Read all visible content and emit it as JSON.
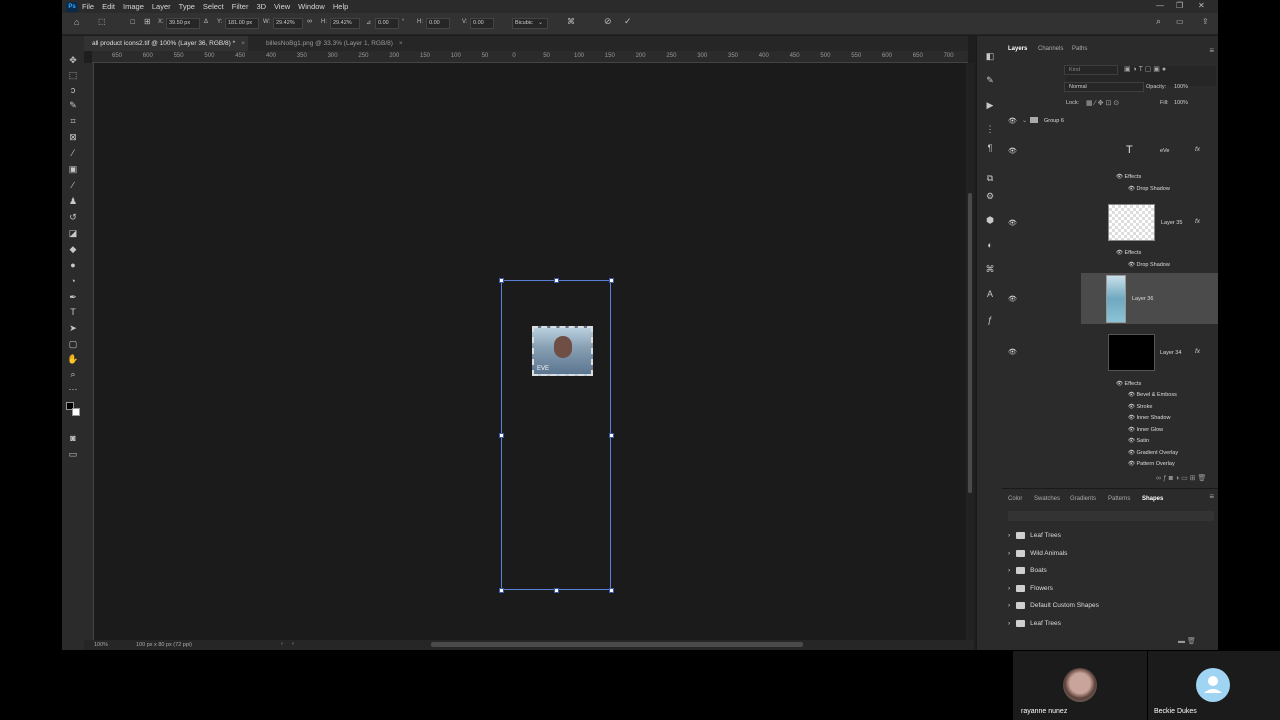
{
  "menubar": {
    "logo": "Ps",
    "items": [
      "File",
      "Edit",
      "Image",
      "Layer",
      "Type",
      "Select",
      "Filter",
      "3D",
      "View",
      "Window",
      "Help"
    ]
  },
  "options": {
    "x_label": "X:",
    "x_value": "39.50 px",
    "y_label": "Y:",
    "y_value": "181.00 px",
    "w_label": "W:",
    "w_value": "29.42%",
    "h_label": "H:",
    "h_value": "29.42%",
    "angle_value": "0.00",
    "hskew_label": "H:",
    "hskew_value": "0.00",
    "vskew_label": "V:",
    "vskew_value": "0.00",
    "interpolation": "Bicubic"
  },
  "tabs": [
    {
      "label": "all product icons2.tif @ 100% (Layer 36, RGB/8) *"
    },
    {
      "label": "billesNoBg1.png @ 33.3% (Layer 1, RGB/8)"
    }
  ],
  "ruler": {
    "h_labels": [
      "650",
      "600",
      "550",
      "500",
      "450",
      "400",
      "350",
      "300",
      "250",
      "200",
      "150",
      "100",
      "50",
      "0",
      "50",
      "100",
      "150",
      "200",
      "250",
      "300",
      "350",
      "400",
      "450",
      "500",
      "550",
      "600",
      "650",
      "700",
      "750"
    ]
  },
  "canvas": {
    "image_text": "EVE"
  },
  "status": {
    "zoom": "100%",
    "doc_size": "100 px x 80 px (72 ppi)"
  },
  "layers_panel": {
    "tabs": [
      "Layers",
      "Channels",
      "Paths"
    ],
    "search_placeholder": "Kind",
    "blend_mode": "Normal",
    "opacity_label": "Opacity:",
    "opacity_value": "100%",
    "lock_label": "Lock:",
    "fill_label": "Fill:",
    "fill_value": "100%",
    "group_name": "Group 6",
    "layers": [
      {
        "name": "eVe",
        "fx": "fx"
      },
      {
        "name": "Layer 35",
        "fx": "fx"
      },
      {
        "name": "Layer 36",
        "fx": ""
      },
      {
        "name": "Layer 34",
        "fx": "fx"
      }
    ],
    "effects_label": "Effects",
    "eve_effects": [
      "Drop Shadow"
    ],
    "layer35_effects": [
      "Drop Shadow"
    ],
    "layer34_effects": [
      "Bevel & Emboss",
      "Stroke",
      "Inner Shadow",
      "Inner Glow",
      "Satin",
      "Gradient Overlay",
      "Pattern Overlay"
    ]
  },
  "shapes_panel": {
    "tabs": [
      "Color",
      "Swatches",
      "Gradients",
      "Patterns",
      "Shapes"
    ],
    "folders": [
      "Leaf Trees",
      "Wild Animals",
      "Boats",
      "Flowers",
      "Default Custom Shapes",
      "Leaf Trees"
    ]
  },
  "call": {
    "participants": [
      {
        "name": "rayanne nunez"
      },
      {
        "name": "Beckie Dukes"
      }
    ]
  },
  "colors": {
    "selection": "#5a7fd8",
    "panel_bg": "#2b2b2b",
    "canvas_bg": "#1b1b1b",
    "avatar_blue": "#9fd4f2"
  }
}
